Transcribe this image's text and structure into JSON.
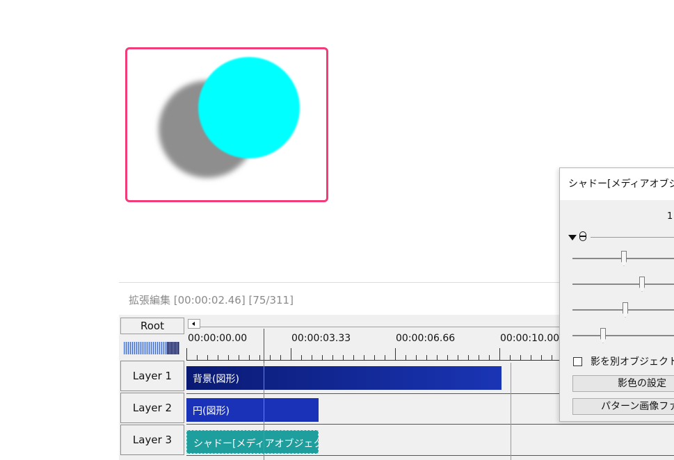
{
  "timeline": {
    "title": "拡張編集 [00:00:02.46] [75/311]",
    "root_label": "Root",
    "ruler": [
      "00:00:00.00",
      "00:00:03.33",
      "00:00:06.66",
      "00:00:10.00"
    ],
    "layers": [
      "Layer 1",
      "Layer 2",
      "Layer 3"
    ],
    "clips": {
      "background": "背景(図形)",
      "circle": "円(図形)",
      "shadow": "シャドー[メディアオブジェクト]"
    }
  },
  "dialog": {
    "title": "シャドー[メディアオブジェクト]",
    "number": "1",
    "checkbox_label": "影を別オブジェクトで描画",
    "shadow_color_button": "影色の設定",
    "pattern_button": "パターン画像ファイル"
  },
  "colors": {
    "preview_border": "#f03c78",
    "circle": "#00ffff",
    "shadow": "#8e8e8e",
    "clip_background": "#0a1a73",
    "clip_circle": "#1a32b8",
    "clip_shadow": "#1f9e9e",
    "playhead": "#e01a1a"
  },
  "icons": {
    "expand": "triangle-down-icon",
    "mouse": "mouse-icon"
  }
}
